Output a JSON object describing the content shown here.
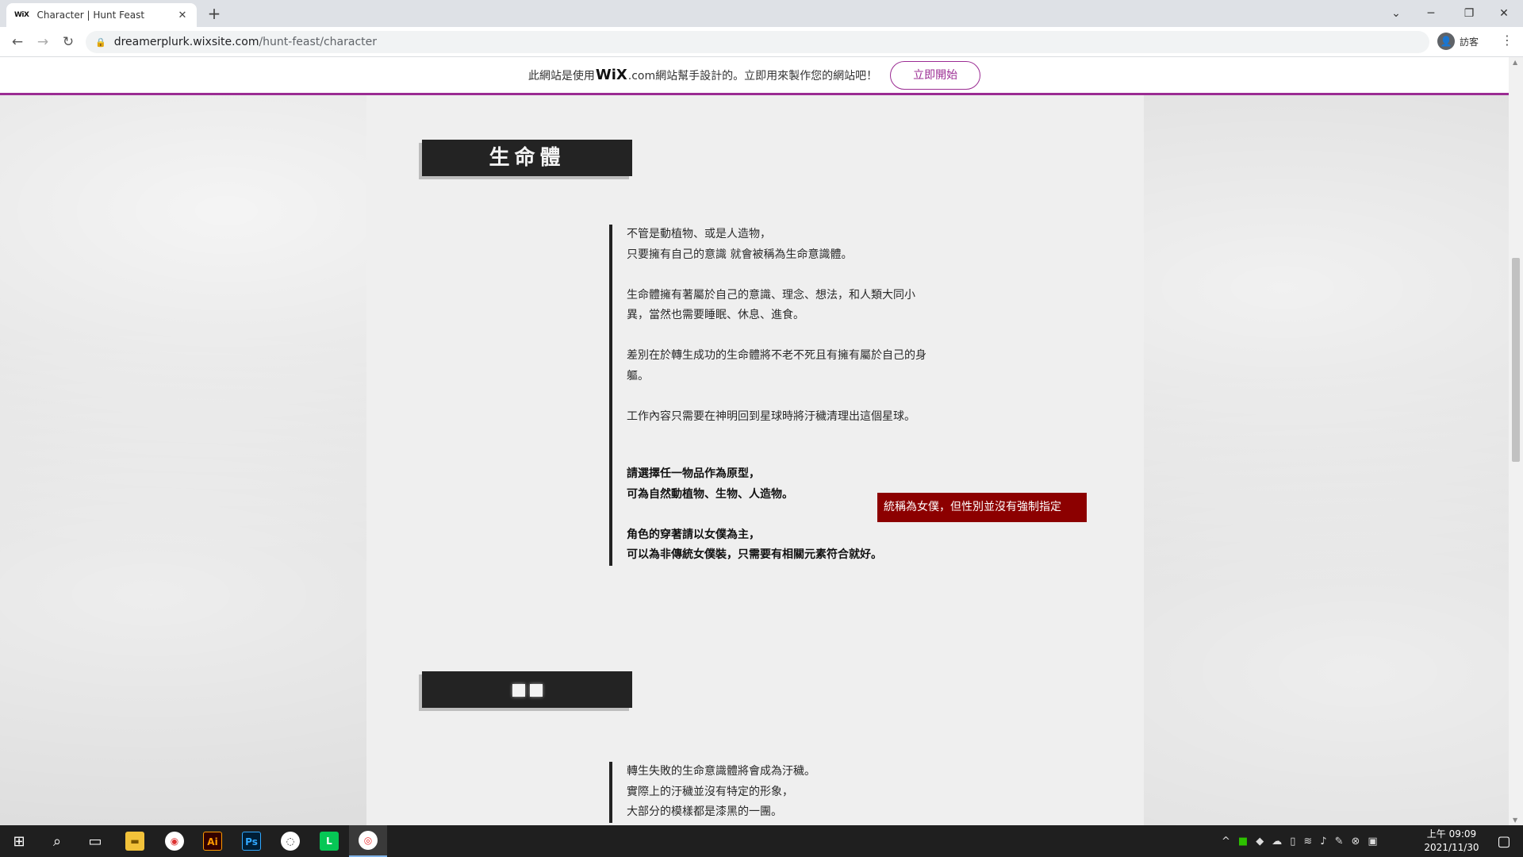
{
  "browser": {
    "tab": {
      "favicon": "WiX",
      "title": "Character | Hunt Feast"
    },
    "url_host": "dreamerplurk.wixsite.com",
    "url_path": "/hunt-feast/character",
    "profile_label": "訪客"
  },
  "wix_banner": {
    "message_before": "此網站是使用",
    "logo": "WiX",
    "message_after": ".com網站幫手設計的。立即用來製作您的網站吧！",
    "cta": "立即開始"
  },
  "section1": {
    "heading": "生命體",
    "paragraphs": [
      "不管是動植物、或是人造物，\n只要擁有自己的意識 就會被稱為生命意識體。",
      "生命體擁有著屬於自己的意識、理念、想法，和人類大同小異，當然也需要睡眠、休息、進食。",
      "差別在於轉生成功的生命體將不老不死且有擁有屬於自己的身軀。",
      "工作內容只需要在神明回到星球時將汙穢清理出這個星球。"
    ],
    "bold_paragraphs": [
      "請選擇任一物品作為原型，\n可為自然動植物、生物、人造物。",
      "角色的穿著請以女僕為主，\n可以為非傳統女僕裝，只需要有相關元素符合就好。"
    ],
    "tag": "統稱為女僕，但性別並沒有強制指定"
  },
  "section2": {
    "paragraphs": [
      "轉生失敗的生命意識體將會成為汙穢。\n實際上的汙穢並沒有特定的形象，\n大部分的模樣都是漆黑的一團。"
    ]
  },
  "taskbar": {
    "clock_period_time": "上午 09:09",
    "clock_date": "2021/11/30",
    "apps": [
      "windows-start",
      "search",
      "task-view",
      "file-explorer",
      "chrome-profile",
      "illustrator",
      "photoshop",
      "line-alt",
      "line",
      "chrome"
    ]
  },
  "colors": {
    "wix_purple": "#9b2c93",
    "tag_red": "#8c0000",
    "heading_bg": "#232323"
  }
}
